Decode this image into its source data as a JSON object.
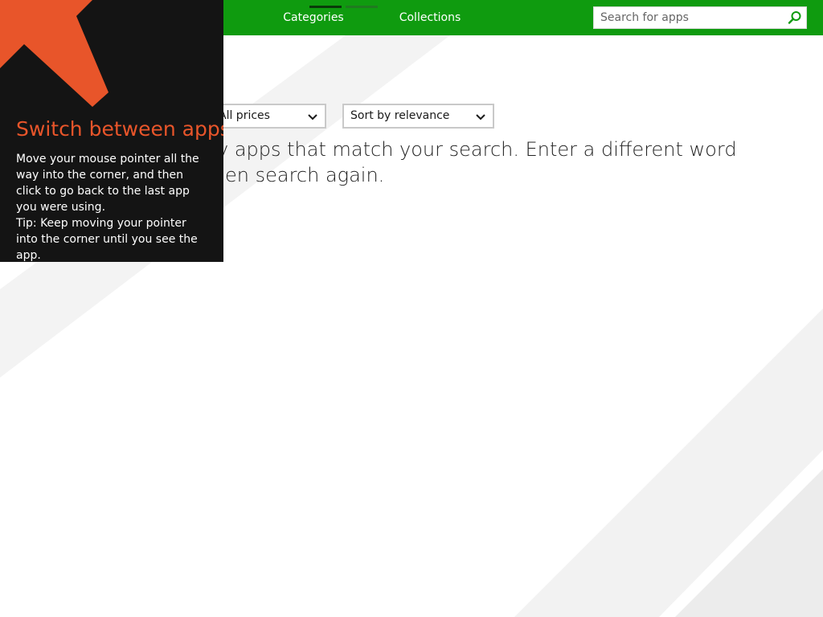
{
  "nav": {
    "tabs": [
      {
        "label": "Categories"
      },
      {
        "label": "Collections"
      }
    ],
    "search": {
      "placeholder": "Search for apps",
      "icon": "search-icon"
    },
    "bar_color": "#0f9b0f"
  },
  "filters": {
    "price": {
      "selected": "All prices",
      "icon": "chevron-down-icon"
    },
    "sort": {
      "selected": "Sort by relevance",
      "icon": "chevron-down-icon"
    }
  },
  "main": {
    "message_line1": "y apps that match your search. Enter a different word",
    "message_line2": "en search again."
  },
  "tutorial": {
    "title": "Switch between apps",
    "body_line1": "Move your mouse pointer all the way into the corner, and then click to go back to the last app you were using.",
    "body_line2": "Tip: Keep moving your pointer into the corner until you see the app.",
    "arrow_icon": "arrow-up-left-icon",
    "accent_color": "#e8552a",
    "background_color": "#141414"
  }
}
